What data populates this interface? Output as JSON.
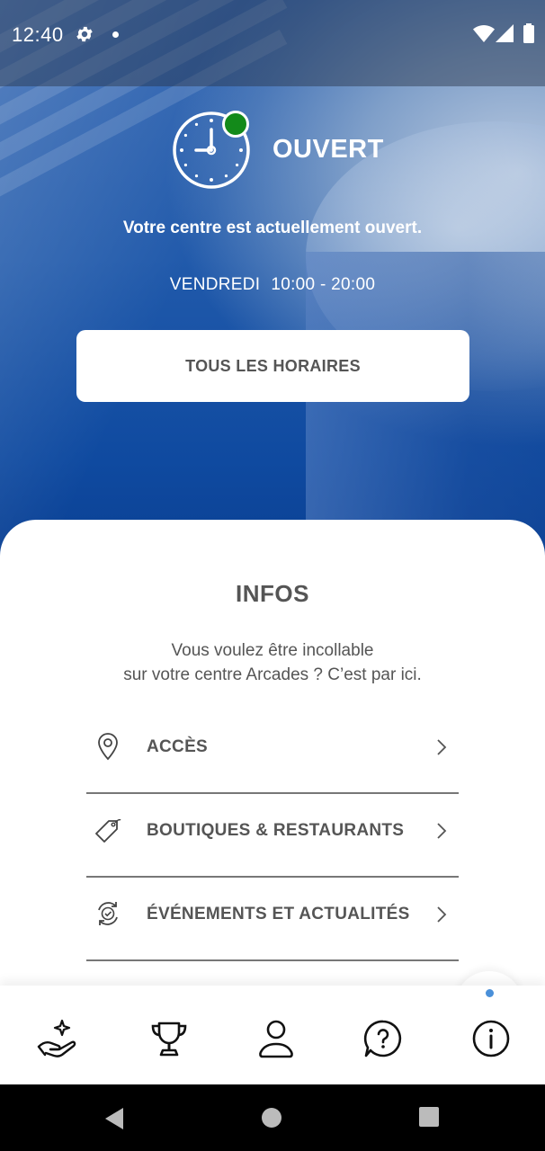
{
  "status_bar": {
    "time": "12:40",
    "icons": [
      "gear-icon",
      "notification-dot",
      "wifi-icon",
      "signal-icon",
      "battery-icon"
    ]
  },
  "hero": {
    "status": "OUVERT",
    "status_color": "#138a1a",
    "message": "Votre centre est actuellement ouvert.",
    "day": "VENDREDI",
    "hours": "10:00 - 20:00",
    "button_label": "TOUS LES HORAIRES"
  },
  "infos": {
    "title": "INFOS",
    "subtitle_line1": "Vous voulez être incollable",
    "subtitle_line2": "sur votre centre Arcades ? C’est par ici.",
    "items": [
      {
        "label": "ACCÈS",
        "icon": "location-pin-icon"
      },
      {
        "label": "BOUTIQUES & RESTAURANTS",
        "icon": "tag-icon"
      },
      {
        "label": "ÉVÉNEMENTS ET ACTUALITÉS",
        "icon": "refresh-check-icon"
      }
    ]
  },
  "bottom_nav": {
    "items": [
      {
        "icon": "hand-sparkle-icon",
        "active": false
      },
      {
        "icon": "trophy-icon",
        "active": false
      },
      {
        "icon": "user-icon",
        "active": false
      },
      {
        "icon": "help-bubble-icon",
        "active": false
      },
      {
        "icon": "info-icon",
        "active": true
      }
    ],
    "active_color": "#4a90d9"
  },
  "android_nav": {
    "buttons": [
      "back-button",
      "home-button",
      "recents-button"
    ]
  }
}
